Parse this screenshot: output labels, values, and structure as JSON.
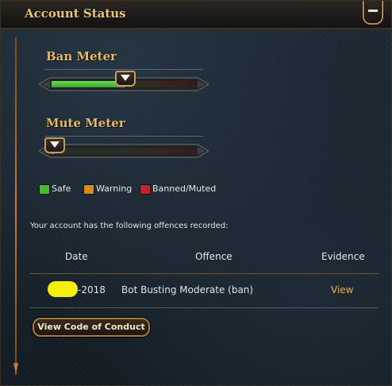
{
  "window": {
    "title": "Account Status",
    "collapse_icon": "minus-icon"
  },
  "meters": {
    "ban": {
      "label": "Ban Meter",
      "level": 0.51
    },
    "mute": {
      "label": "Mute Meter",
      "level": 0.02
    }
  },
  "legend": [
    {
      "label": "Safe",
      "color": "#3fbf2f"
    },
    {
      "label": "Warning",
      "color": "#d98a1f"
    },
    {
      "label": "Banned/Muted",
      "color": "#c8202e"
    }
  ],
  "offences": {
    "intro": "Your account has the following offences recorded:",
    "columns": [
      "Date",
      "Offence",
      "Evidence"
    ],
    "rows": [
      {
        "date": "-2018",
        "offence": "Bot Busting Moderate (ban)",
        "evidence": "View"
      }
    ]
  },
  "buttons": {
    "code_of_conduct": "View Code of Conduct"
  },
  "colors": {
    "accent_gold": "#e8c66a",
    "link": "#e6b448",
    "meter_fill": "#4fc93a",
    "redaction": "#f4ef0c"
  }
}
